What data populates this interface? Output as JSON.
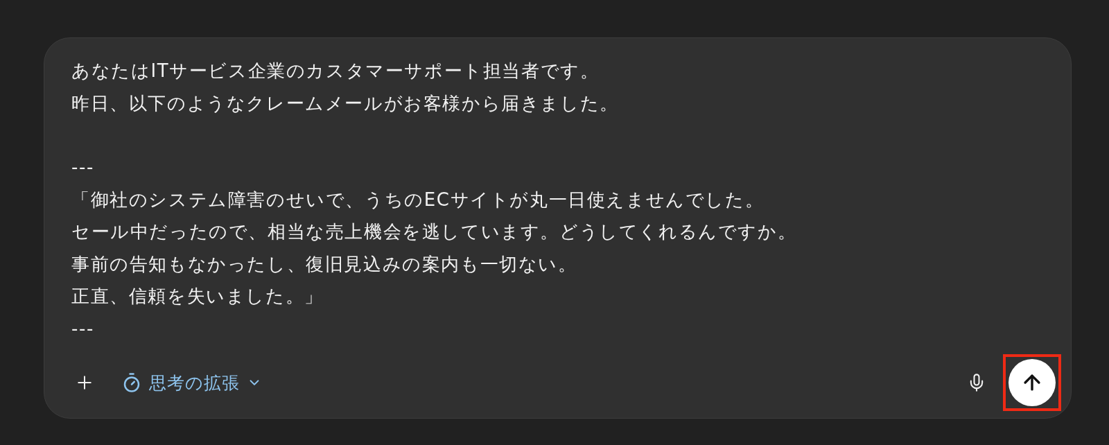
{
  "prompt": {
    "paragraphs": [
      [
        "あなたはITサービス企業のカスタマーサポート担当者です。",
        "昨日、以下のようなクレームメールがお客様から届きました。"
      ],
      [
        "---",
        "「御社のシステム障害のせいで、うちのECサイトが丸一日使えませんでした。",
        "セール中だったので、相当な売上機会を逃しています。どうしてくれるんですか。",
        "事前の告知もなかったし、復旧見込みの案内も一切ない。",
        "正直、信頼を失いました。」",
        "---"
      ]
    ]
  },
  "toolbar": {
    "mode": {
      "label": "思考の拡張",
      "selected": true
    }
  },
  "send_button": {
    "highlighted": true,
    "disabled": false
  }
}
